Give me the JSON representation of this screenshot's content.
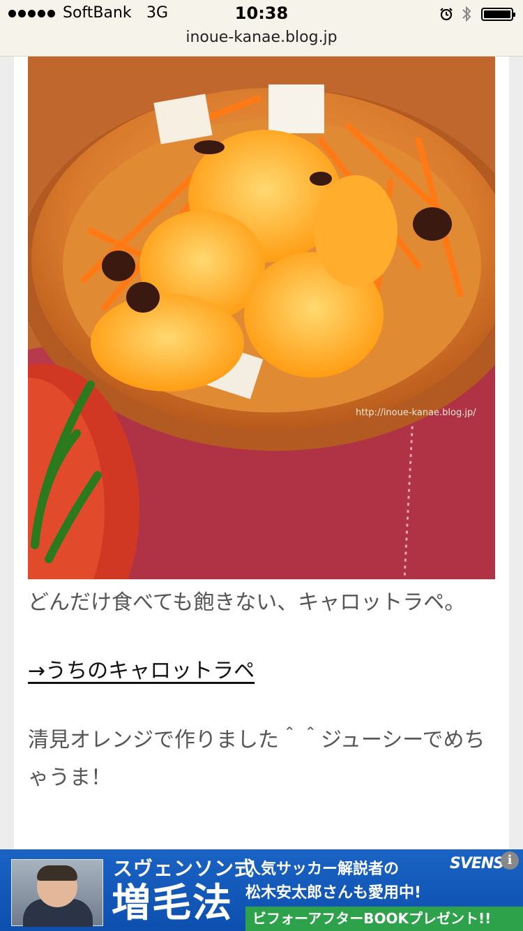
{
  "status_bar": {
    "carrier": "SoftBank",
    "network": "3G",
    "time": "10:38"
  },
  "browser": {
    "url": "inoue-kanae.blog.jp"
  },
  "post": {
    "image_watermark": "http://inoue-kanae.blog.jp/",
    "caption": "どんだけ食べても飽きない、キャロットラペ。",
    "link_text": "→うちのキャロットラペ",
    "body_text": "清見オレンジで作りました＾＾ジューシーでめちゃうま！"
  },
  "ad": {
    "title_small": "スヴェンソン式",
    "title_large": "増毛法",
    "line1": "人気サッカー解説者の",
    "line2": "松木安太郎さんも愛用中!",
    "cta": "ビフォーアフターBOOKプレゼント!!",
    "brand": "SVENSO",
    "info_glyph": "i"
  },
  "icons": [
    "signal-dots-icon",
    "alarm-icon",
    "bluetooth-icon",
    "battery-icon",
    "ad-info-icon"
  ]
}
